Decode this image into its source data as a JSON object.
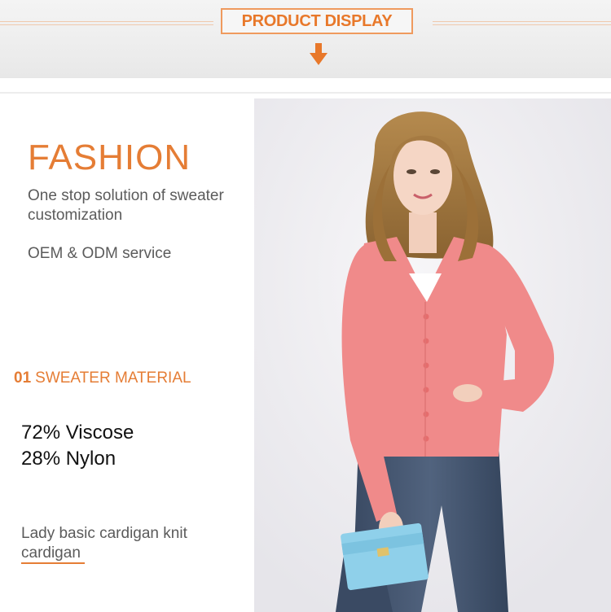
{
  "header": {
    "title": "PRODUCT DISPLAY",
    "accent_color": "#e8782a",
    "arrow_icon": "arrow-down-icon"
  },
  "main": {
    "headline": "FASHION",
    "tagline": "One stop solution of sweater customization",
    "service": "OEM & ODM service",
    "section": {
      "number": "01",
      "label": "SWEATER MATERIAL"
    },
    "composition": [
      "72% Viscose",
      "28% Nylon"
    ],
    "description": "Lady basic cardigan knit cardigan",
    "photo": "model-pink-cardigan-photo"
  }
}
